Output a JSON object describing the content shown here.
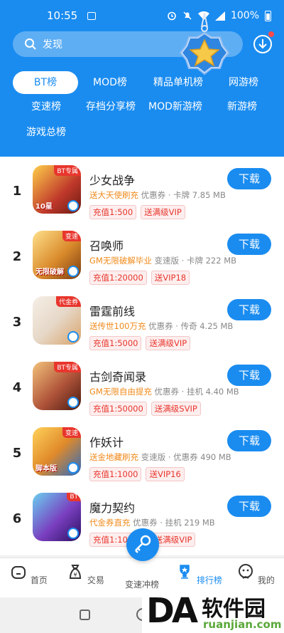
{
  "status": {
    "time": "10:55",
    "battery": "100%"
  },
  "search": {
    "placeholder": "发现"
  },
  "tabs": [
    {
      "label": "BT榜",
      "active": true
    },
    {
      "label": "MOD榜"
    },
    {
      "label": "精品单机榜"
    },
    {
      "label": "网游榜"
    },
    {
      "label": "变速榜"
    },
    {
      "label": "存档分享榜"
    },
    {
      "label": "MOD新游榜"
    },
    {
      "label": "新游榜"
    },
    {
      "label": "游戏总榜"
    }
  ],
  "games": [
    {
      "rank": "1",
      "name": "少女战争",
      "promo": "送大天使刷充",
      "meta": " 优惠券 · 卡牌 7.85 MB",
      "chips": [
        "充值1:500",
        "送满级VIP"
      ],
      "button": "下载",
      "icon_tag": "BT专属",
      "icon_label": "10星",
      "icon_color": "#c0392b"
    },
    {
      "rank": "2",
      "name": "召唤师",
      "promo": "GM无限破解毕业",
      "meta": " 变速版 · 卡牌 222 MB",
      "chips": [
        "充值1:20000",
        "送VIP18"
      ],
      "button": "下载",
      "icon_tag": "变速",
      "icon_label": "无限破解",
      "icon_color": "#d98a2b"
    },
    {
      "rank": "3",
      "name": "雷霆前线",
      "promo": "送传世100万充",
      "meta": " 优惠券 · 传奇 4.25 MB",
      "chips": [
        "充值1:5000",
        "送满级VIP"
      ],
      "button": "下载",
      "icon_tag": "代金券",
      "icon_label": "",
      "icon_color": "#e6d8c8"
    },
    {
      "rank": "4",
      "name": "古剑奇闻录",
      "promo": "GM无限自由提充",
      "meta": " 优惠券 · 挂机 4.40 MB",
      "chips": [
        "充值1:50000",
        "送满级SVIP"
      ],
      "button": "下载",
      "icon_tag": "BT专属",
      "icon_label": "",
      "icon_color": "#b0543a"
    },
    {
      "rank": "5",
      "name": "作妖计",
      "promo": "送金地藏刷充",
      "meta": " 变速版 · 优惠券 490 MB",
      "chips": [
        "充值1:1000",
        "送VIP16"
      ],
      "button": "下载",
      "icon_tag": "变速",
      "icon_label": "脚本版",
      "icon_color": "#e08a2a"
    },
    {
      "rank": "6",
      "name": "魔力契约",
      "promo": "代金券直充",
      "meta": " 优惠券 · 挂机 219 MB",
      "chips": [
        "充值1:10000",
        "送满级VIP"
      ],
      "button": "下载",
      "icon_tag": "BT",
      "icon_label": "",
      "icon_color": "#7a3fc0"
    }
  ],
  "nav": [
    {
      "label": "首页"
    },
    {
      "label": "交易"
    },
    {
      "label": "变速冲榜"
    },
    {
      "label": "排行榜",
      "active": true
    },
    {
      "label": "我的"
    }
  ],
  "watermark": {
    "logo": "DA",
    "text": "软件园",
    "url": "ruanjian.com"
  },
  "colors": {
    "primary": "#1a8cf0",
    "promo": "#f08a1a",
    "chip": "#e8362d"
  }
}
